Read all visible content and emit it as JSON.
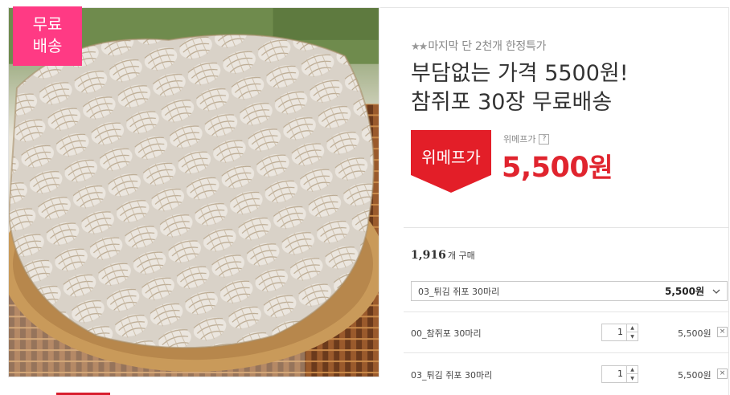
{
  "badge": {
    "line1": "무료",
    "line2": "배송"
  },
  "subtitle": {
    "stars": "★★",
    "text": "마지막 단 2천개 한정특가"
  },
  "title": {
    "line1": "부담없는 가격 5500원!",
    "line2": "참쥐포 30장 무료배송"
  },
  "price_tag": {
    "label": "위메프가"
  },
  "price": {
    "label": "위메프가",
    "help": "?",
    "value": "5,500",
    "unit": "원"
  },
  "purchase": {
    "count": "1,916",
    "suffix": "개 구매"
  },
  "option_select": {
    "name": "03_튀김 쥐포 30마리",
    "price": "5,500원"
  },
  "options": [
    {
      "name": "00_참쥐포 30마리",
      "qty": "1",
      "price": "5,500원",
      "remove": "×"
    },
    {
      "name": "03_튀김 쥐포 30마리",
      "qty": "1",
      "price": "5,500원",
      "remove": "×"
    }
  ],
  "colors": {
    "accent": "#e0242e",
    "badge": "#ff3a84",
    "tag": "#e31e28"
  }
}
